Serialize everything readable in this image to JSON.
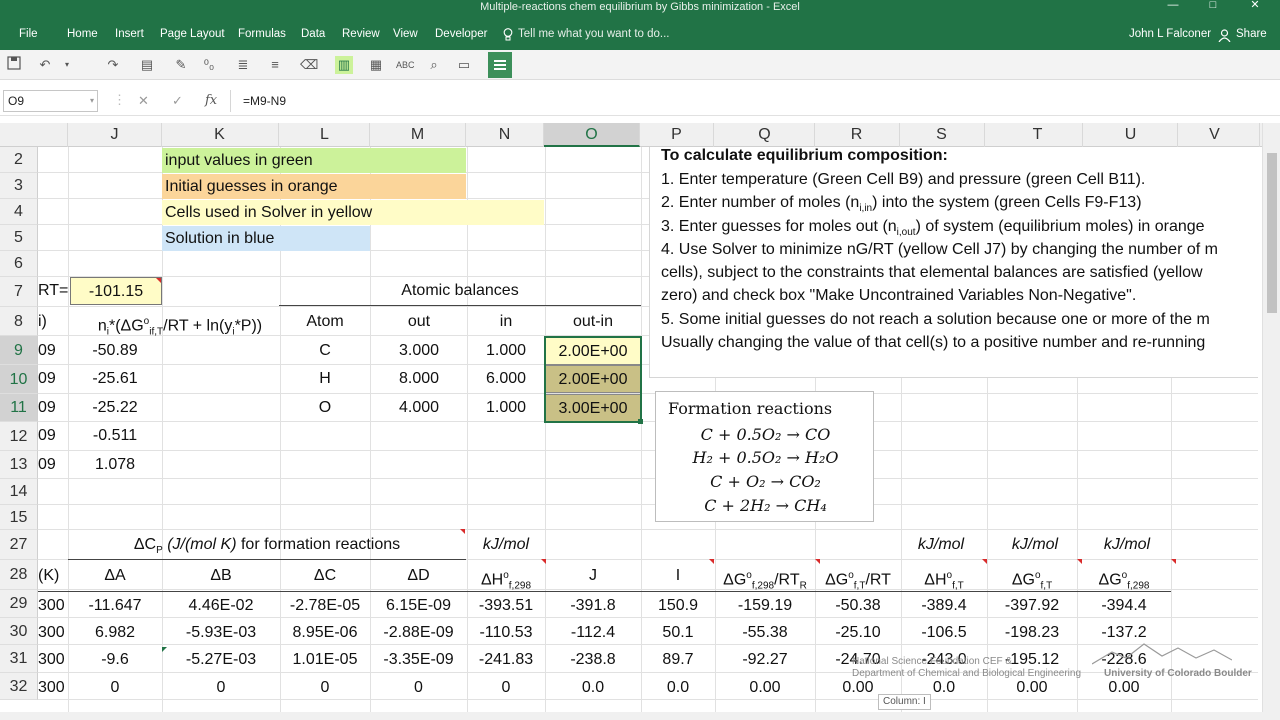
{
  "window": {
    "title": "Multiple-reactions chem equilibrium by Gibbs minimization - Excel",
    "controls": [
      "—",
      "□",
      "✕"
    ]
  },
  "ribbon": {
    "tabs": [
      "File",
      "Home",
      "Insert",
      "Page Layout",
      "Formulas",
      "Data",
      "Review",
      "View",
      "Developer"
    ],
    "tell_me": "Tell me what you want to do...",
    "user": "John L Falconer",
    "share": "Share"
  },
  "formula_bar": {
    "name_box": "O9",
    "cancel": "✕",
    "enter": "✓",
    "fx": "fx",
    "formula": "=M9-N9"
  },
  "columns": [
    "J",
    "K",
    "L",
    "M",
    "N",
    "O",
    "P",
    "Q",
    "R",
    "S",
    "T",
    "U",
    "V"
  ],
  "rows": [
    "2",
    "3",
    "4",
    "5",
    "6",
    "7",
    "8",
    "9",
    "10",
    "11",
    "12",
    "13",
    "14",
    "15",
    "27",
    "28",
    "29",
    "30",
    "31",
    "32"
  ],
  "legend": {
    "input": "input values in green",
    "guesses": "Initial guesses in orange",
    "solver": "Cells used in Solver in yellow",
    "solution": "Solution in blue"
  },
  "row7": {
    "partial_label": "RT=",
    "value": "-101.15",
    "atomic_header": "Atomic balances"
  },
  "row8": {
    "partial": "i)",
    "j_header": "nᵢ*(ΔGᵒif,T/RT + ln(yᵢ*P))",
    "atom": "Atom",
    "out": "out",
    "in": "in",
    "out_in": "out-in"
  },
  "species_rows": [
    {
      "partial": "09",
      "j": "-50.89"
    },
    {
      "partial": "09",
      "j": "-25.61"
    },
    {
      "partial": "09",
      "j": "-25.22"
    },
    {
      "partial": "09",
      "j": "-0.511"
    },
    {
      "partial": "09",
      "j": "1.078"
    }
  ],
  "atomic_balance": [
    {
      "atom": "C",
      "out": "3.000",
      "in": "1.000",
      "diff": "2.00E+00"
    },
    {
      "atom": "H",
      "out": "8.000",
      "in": "6.000",
      "diff": "2.00E+00"
    },
    {
      "atom": "O",
      "out": "4.000",
      "in": "1.000",
      "diff": "3.00E+00"
    }
  ],
  "instructions": {
    "title": "To calculate equilibrium composition:",
    "lines": [
      "1. Enter temperature (Green Cell B9) and pressure (green Cell B11).",
      "2. Enter number of moles (n",
      "3. Enter guesses for moles out (n",
      "4. Use Solver to minimize nG/RT (yellow Cell J7) by changing the number of m",
      "cells), subject to the constraints that elemental balances are satisfied (yellow",
      "zero) and check box \"Make Uncontrained Variables Non-Negative\".",
      "5. Some initial guesses do not reach a solution because one or more of the m",
      "Usually changing the value of that cell(s) to a positive number and re-running"
    ],
    "line2_sub": "i,in",
    "line2_rest": ") into the system (green Cells F9-F13)",
    "line3_sub": "i,out",
    "line3_rest": ") of system (equilibrium moles) in orange"
  },
  "formation": {
    "title": "Formation reactions",
    "equations": [
      "C + 0.5O₂ → CO",
      "H₂ + 0.5O₂ → H₂O",
      "C + O₂ → CO₂",
      "C + 2H₂ → CH₄"
    ]
  },
  "row27": {
    "cp_header": "ΔCP (J/(mol K)  for formation reactions",
    "n": "kJ/mol",
    "s": "kJ/mol",
    "t": "kJ/mol",
    "u": "kJ/mol"
  },
  "row28": {
    "partial": "(K)",
    "cols": [
      "ΔA",
      "ΔB",
      "ΔC",
      "ΔD",
      "ΔHᵒf,298",
      "J",
      "I",
      "ΔGᵒf,298/RTR",
      "ΔGᵒf,T/RT",
      "ΔHᵒf,T",
      "ΔGᵒf,T",
      "ΔGᵒf,298"
    ]
  },
  "data_rows": [
    {
      "partial": "300",
      "cells": [
        "-11.647",
        "4.46E-02",
        "-2.78E-05",
        "6.15E-09",
        "-393.51",
        "-391.8",
        "150.9",
        "-159.19",
        "-50.38",
        "-389.4",
        "-397.92",
        "-394.4"
      ]
    },
    {
      "partial": "300",
      "cells": [
        "6.982",
        "-5.93E-03",
        "8.95E-06",
        "-2.88E-09",
        "-110.53",
        "-112.4",
        "50.1",
        "-55.38",
        "-25.10",
        "-106.5",
        "-198.23",
        "-137.2"
      ]
    },
    {
      "partial": "300",
      "cells": [
        "-9.6",
        "-5.27E-03",
        "1.01E-05",
        "-3.35E-09",
        "-241.83",
        "-238.8",
        "89.7",
        "-92.27",
        "-24.70",
        "-243.0",
        "-195.12",
        "-228.6"
      ]
    },
    {
      "partial": "300",
      "cells": [
        "0",
        "0",
        "0",
        "0",
        "0",
        "0.0",
        "0.0",
        "0.00",
        "0.00",
        "0.0",
        "0.00",
        "0.00"
      ]
    }
  ],
  "watermark": {
    "line1": "National Science Foundation  CEF &",
    "line2": "Department of Chemical and Biological Engineering",
    "line3": "University of Colorado Boulder"
  },
  "tooltip": "Column: I"
}
